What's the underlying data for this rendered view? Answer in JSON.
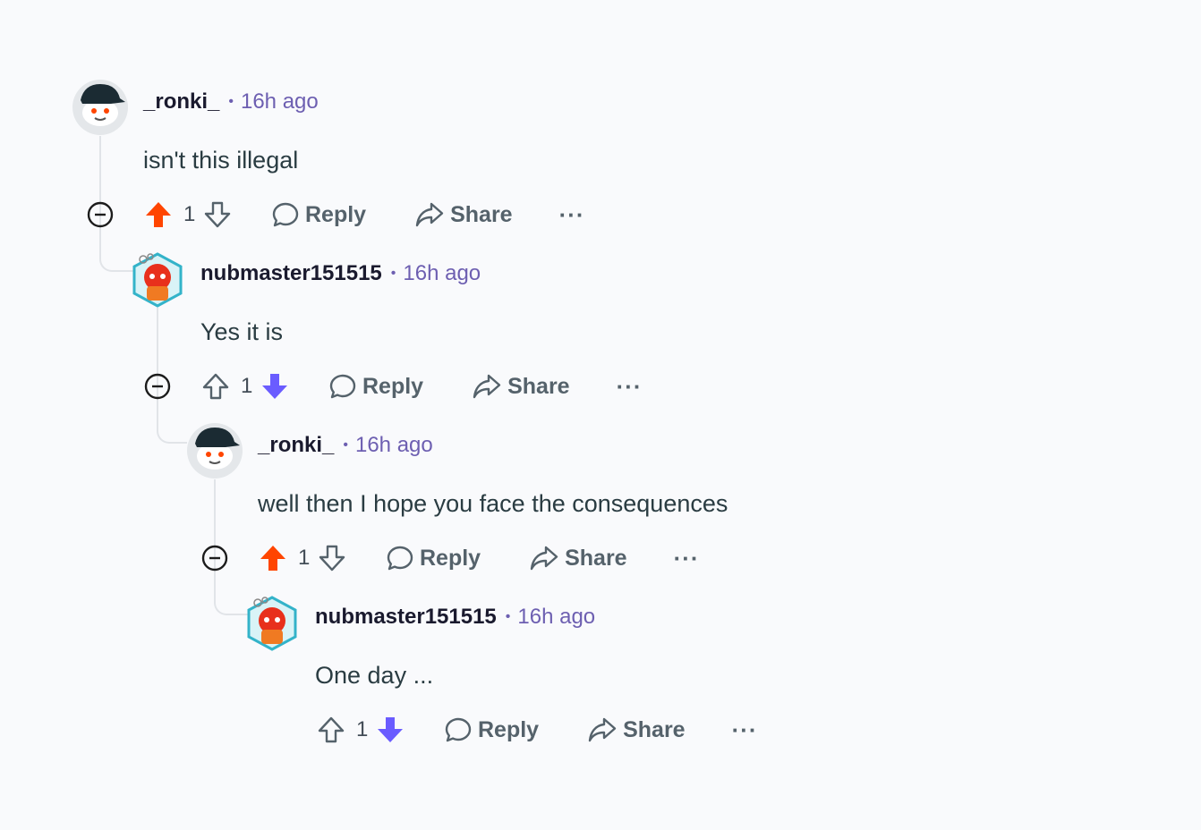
{
  "colors": {
    "upvote_active": "#ff4500",
    "downvote_active": "#6a5cff",
    "meta": "#6d5fb1",
    "action_text": "#55626b",
    "thread_line": "#e1e4e8"
  },
  "comments": [
    {
      "author": "_ronki_",
      "time": "16h ago",
      "body": "isn't this illegal",
      "score": "1",
      "vote": "up",
      "collapsible": true,
      "avatar": "snoo-avatar-cap"
    },
    {
      "author": "nubmaster151515",
      "time": "16h ago",
      "body": "Yes it is",
      "score": "1",
      "vote": "down",
      "collapsible": true,
      "avatar": "snoo-avatar-robot"
    },
    {
      "author": "_ronki_",
      "time": "16h ago",
      "body": "well then I hope you face the consequences",
      "score": "1",
      "vote": "up",
      "collapsible": true,
      "avatar": "snoo-avatar-cap"
    },
    {
      "author": "nubmaster151515",
      "time": "16h ago",
      "body": "One day ...",
      "score": "1",
      "vote": "down",
      "collapsible": false,
      "avatar": "snoo-avatar-robot"
    }
  ],
  "actions": {
    "reply_label": "Reply",
    "share_label": "Share",
    "more_label": "···",
    "separator": "•"
  }
}
